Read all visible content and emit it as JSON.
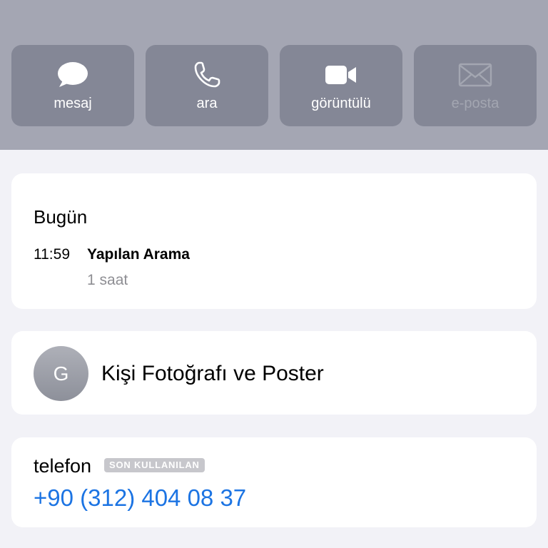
{
  "colors": {
    "header_background": "#a4a6b3",
    "action_button_background": "#848796",
    "page_background": "#f2f2f7",
    "link": "#1c74e3",
    "secondary_text": "#8e8e93"
  },
  "actions": [
    {
      "label": "mesaj",
      "icon": "message-bubble-icon",
      "enabled": true
    },
    {
      "label": "ara",
      "icon": "phone-icon",
      "enabled": true
    },
    {
      "label": "görüntülü",
      "icon": "video-camera-icon",
      "enabled": true
    },
    {
      "label": "e-posta",
      "icon": "envelope-icon",
      "enabled": false
    }
  ],
  "recents": {
    "day": "Bugün",
    "entries": [
      {
        "time": "11:59",
        "type": "Yapılan Arama",
        "duration": "1 saat"
      }
    ]
  },
  "contact_poster": {
    "initial": "G",
    "label": "Kişi Fotoğrafı ve Poster"
  },
  "phone": {
    "label": "telefon",
    "badge": "SON KULLANILAN",
    "number": "+90 (312) 404 08 37"
  }
}
